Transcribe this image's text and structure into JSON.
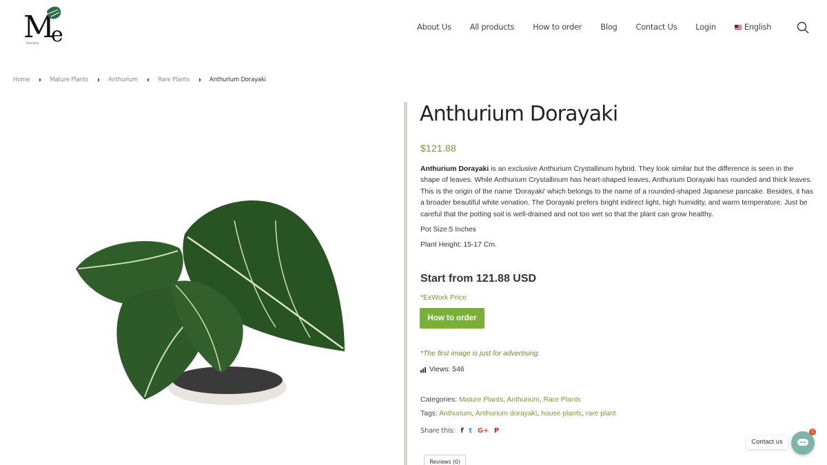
{
  "header": {
    "nav": [
      {
        "label": "About Us"
      },
      {
        "label": "All products"
      },
      {
        "label": "How to order"
      },
      {
        "label": "Blog"
      },
      {
        "label": "Contact Us"
      },
      {
        "label": "Login"
      }
    ],
    "language": "English"
  },
  "breadcrumb": [
    "Home",
    "Mature Plants",
    "Anthurium",
    "Rare Plants",
    "Anthurium Dorayaki"
  ],
  "product": {
    "title": "Anthurium Dorayaki",
    "price": "$121.88",
    "description_bold": "Anthurium Dorayaki",
    "description_rest": " is an exclusive Anthurium Crystallinum hybrid. They look similar but the difference is seen in the shape of leaves. While Anthurium Crystallinum has heart-shaped leaves, Anthurium Dorayaki has rounded and thick leaves. This is the origin of the name 'Dorayaki' which belongs to the name of a rounded-shaped Japanese pancake. Besides, it has a broader beautiful white venation. The  Dorayaki prefers bright indirect light, high humidity, and warm temperature. Just be careful that the potting soil is well-drained and not too wet so that the plant can grow healthy.",
    "pot_size": "Pot Size:5  Inches",
    "plant_height": "Plant Height: 15-17  Cm.",
    "start_from": "Start from 121.88 USD",
    "exwork": "*ExWork Price",
    "order_button": "How to order",
    "advert_note": "*The first image is just for advertising.",
    "views_label": "Views: 546",
    "categories_label": "Categories:",
    "categories": [
      "Mature Plants",
      "Anthurium",
      "Rare Plants"
    ],
    "tags_label": "Tags:",
    "tags": [
      "Anthurium",
      "Anthurium dorayaki",
      "house plants",
      "rare plant"
    ],
    "share_label": "Share this:",
    "share": [
      {
        "icon": "facebook-icon",
        "glyph": "f",
        "color": "#333333"
      },
      {
        "icon": "twitter-icon",
        "glyph": "t",
        "color": "#1da1f2"
      },
      {
        "icon": "google-plus-icon",
        "glyph": "G+",
        "color": "#dd4b39"
      },
      {
        "icon": "pinterest-icon",
        "glyph": "P",
        "color": "#cb2027"
      }
    ],
    "reviews_tab": "Reviews (0)"
  },
  "contact_widget": {
    "label": "Contact us",
    "badge": "1"
  },
  "colors": {
    "accent_green": "#7ab03a",
    "price_green": "#7a9a2e",
    "widget_teal": "#7fb5a9"
  }
}
